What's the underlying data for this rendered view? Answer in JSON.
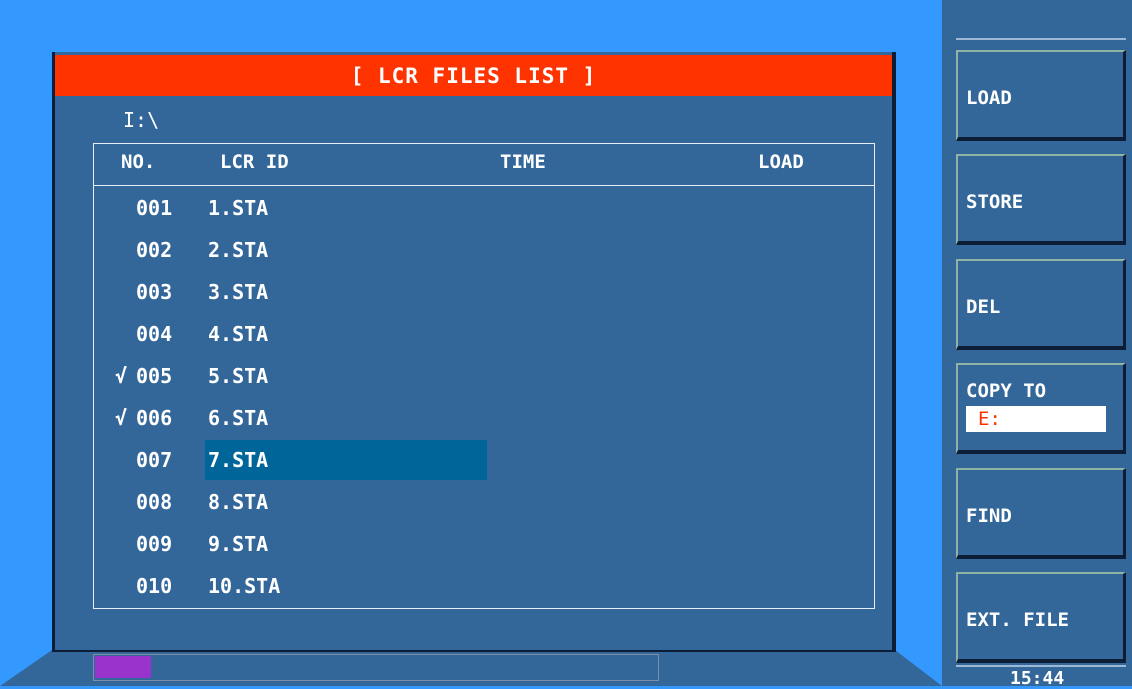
{
  "title": "[ LCR FILES LIST ]",
  "path": "I:\\",
  "table": {
    "headers": {
      "no": "NO.",
      "lcr_id": "LCR ID",
      "time": "TIME",
      "load": "LOAD"
    },
    "rows": [
      {
        "check": "",
        "no": "001",
        "id": "1.STA",
        "time": "",
        "load": ""
      },
      {
        "check": "",
        "no": "002",
        "id": "2.STA",
        "time": "",
        "load": ""
      },
      {
        "check": "",
        "no": "003",
        "id": "3.STA",
        "time": "",
        "load": ""
      },
      {
        "check": "",
        "no": "004",
        "id": "4.STA",
        "time": "",
        "load": ""
      },
      {
        "check": "√",
        "no": "005",
        "id": "5.STA",
        "time": "",
        "load": ""
      },
      {
        "check": "√",
        "no": "006",
        "id": "6.STA",
        "time": "",
        "load": ""
      },
      {
        "check": "",
        "no": "007",
        "id": "7.STA",
        "time": "",
        "load": ""
      },
      {
        "check": "",
        "no": "008",
        "id": "8.STA",
        "time": "",
        "load": ""
      },
      {
        "check": "",
        "no": "009",
        "id": "9.STA",
        "time": "",
        "load": ""
      },
      {
        "check": "",
        "no": "010",
        "id": "10.STA",
        "time": "",
        "load": ""
      }
    ],
    "selected_row": 6
  },
  "scroll_progress": 0.1,
  "softkeys": {
    "load": "LOAD",
    "store": "STORE",
    "del": "DEL",
    "copy_to": "COPY TO",
    "copy_to_drive": "E:",
    "find": "FIND",
    "ext_file": "EXT. FILE"
  },
  "clock": "15:44",
  "colors": {
    "background": "#3399ff",
    "panel": "#336699",
    "title_bar": "#ff3300",
    "selection": "#006699",
    "progress": "#9933cc"
  }
}
